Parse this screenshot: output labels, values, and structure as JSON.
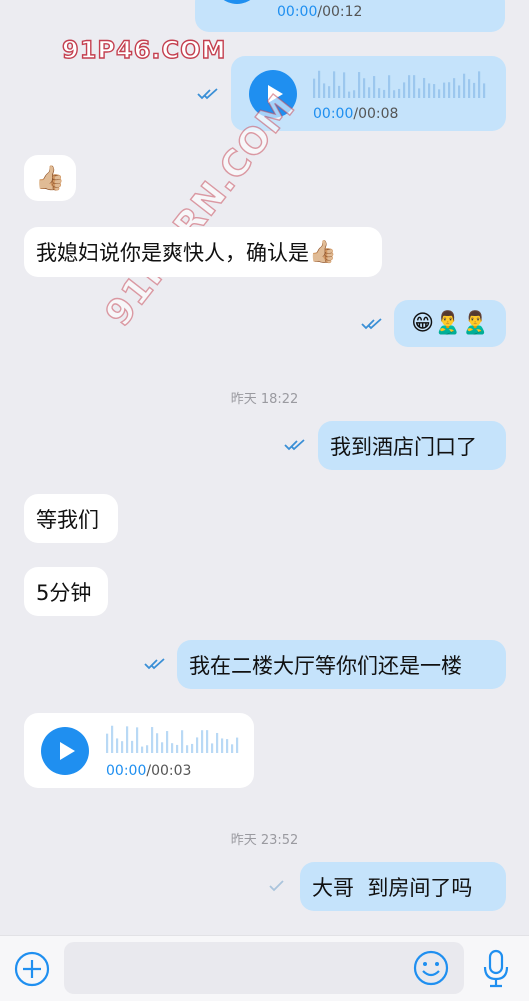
{
  "messages": [
    {
      "id": "voice-out-1",
      "type": "voice",
      "dir": "out",
      "current": "00:00",
      "total": "00:12"
    },
    {
      "id": "voice-out-2",
      "type": "voice",
      "dir": "out",
      "current": "00:00",
      "total": "00:08",
      "read": true
    },
    {
      "id": "emoji-in-1",
      "type": "emoji",
      "dir": "in",
      "emoji": "👍🏼"
    },
    {
      "id": "text-in-1",
      "type": "text",
      "dir": "in",
      "text": "我媳妇说你是爽快人，确认是",
      "emoji": "👍🏼"
    },
    {
      "id": "emoji-out-1",
      "type": "emoji",
      "dir": "out",
      "emoji": "😁🙎‍♂️🙎‍♂️",
      "read": true
    },
    {
      "id": "ts-1",
      "type": "timestamp",
      "text": "昨天 18:22"
    },
    {
      "id": "text-out-1",
      "type": "text",
      "dir": "out",
      "text": "我到酒店门口了",
      "read": true
    },
    {
      "id": "text-in-2",
      "type": "text",
      "dir": "in",
      "text": "等我们"
    },
    {
      "id": "text-in-3",
      "type": "text",
      "dir": "in",
      "text": "5分钟"
    },
    {
      "id": "text-out-2",
      "type": "text",
      "dir": "out",
      "text": "我在二楼大厅等你们还是一楼",
      "read": true
    },
    {
      "id": "voice-in-1",
      "type": "voice",
      "dir": "in",
      "current": "00:00",
      "total": "00:03"
    },
    {
      "id": "ts-2",
      "type": "timestamp",
      "text": "昨天 23:52"
    },
    {
      "id": "text-out-3",
      "type": "text",
      "dir": "out",
      "text": "大哥  到房间了吗",
      "read": false
    }
  ],
  "watermarks": {
    "primary": "91P46.COM",
    "diagonal": "91PORN.COM"
  },
  "input_bar": {
    "add_icon": "plus-circle-icon",
    "emoji_icon": "smiley-icon",
    "voice_icon": "microphone-icon"
  },
  "colors": {
    "outgoing_bubble": "#c5e3fb",
    "incoming_bubble": "#ffffff",
    "accent": "#1f8ff0",
    "background": "#ececf1"
  }
}
